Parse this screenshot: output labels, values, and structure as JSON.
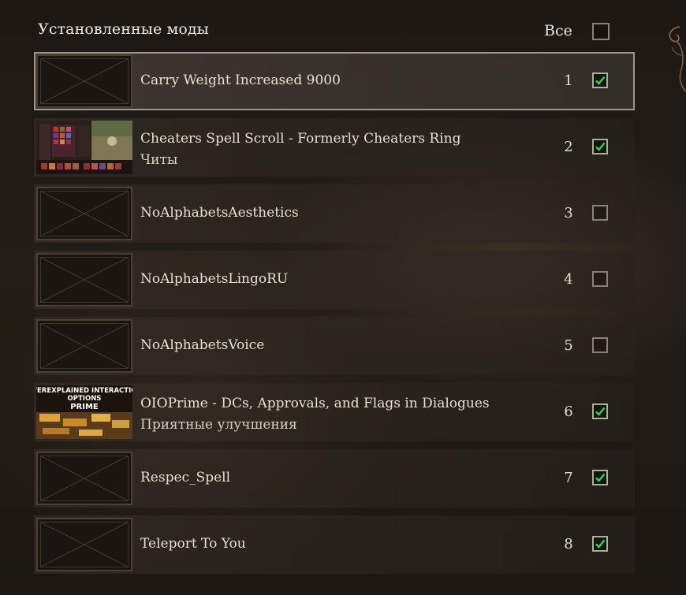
{
  "header": {
    "title": "Установленные моды",
    "all_label": "Все",
    "all_checked": false
  },
  "mods": [
    {
      "name": "Carry Weight Increased 9000",
      "subtitle": "",
      "order": "1",
      "checked": true,
      "thumbnail": "placeholder",
      "selected": true
    },
    {
      "name": "Cheaters Spell Scroll - Formerly Cheaters Ring",
      "subtitle": "Читы",
      "order": "2",
      "checked": true,
      "thumbnail": "game-screenshot",
      "selected": false
    },
    {
      "name": "NoAlphabetsAesthetics",
      "subtitle": "",
      "order": "3",
      "checked": false,
      "thumbnail": "placeholder",
      "selected": false
    },
    {
      "name": "NoAlphabetsLingoRU",
      "subtitle": "",
      "order": "4",
      "checked": false,
      "thumbnail": "placeholder",
      "selected": false
    },
    {
      "name": "NoAlphabetsVoice",
      "subtitle": "",
      "order": "5",
      "checked": false,
      "thumbnail": "placeholder",
      "selected": false
    },
    {
      "name": "OIOPrime - DCs, Approvals, and Flags in Dialogues",
      "subtitle": "Приятные улучшения",
      "order": "6",
      "checked": true,
      "thumbnail": "oio-banner",
      "selected": false
    },
    {
      "name": "Respec_Spell",
      "subtitle": "",
      "order": "7",
      "checked": true,
      "thumbnail": "placeholder",
      "selected": false
    },
    {
      "name": "Teleport To You",
      "subtitle": "",
      "order": "8",
      "checked": true,
      "thumbnail": "placeholder",
      "selected": false
    }
  ],
  "thumb_text": {
    "oio": {
      "line1": "OVEREXPLAINED INTERACTION",
      "line2": "OPTIONS",
      "line3": "PRIME"
    }
  },
  "colors": {
    "check_green": "#3ccf4e",
    "background": "#1f1a16",
    "selected_border": "#9d968c"
  }
}
